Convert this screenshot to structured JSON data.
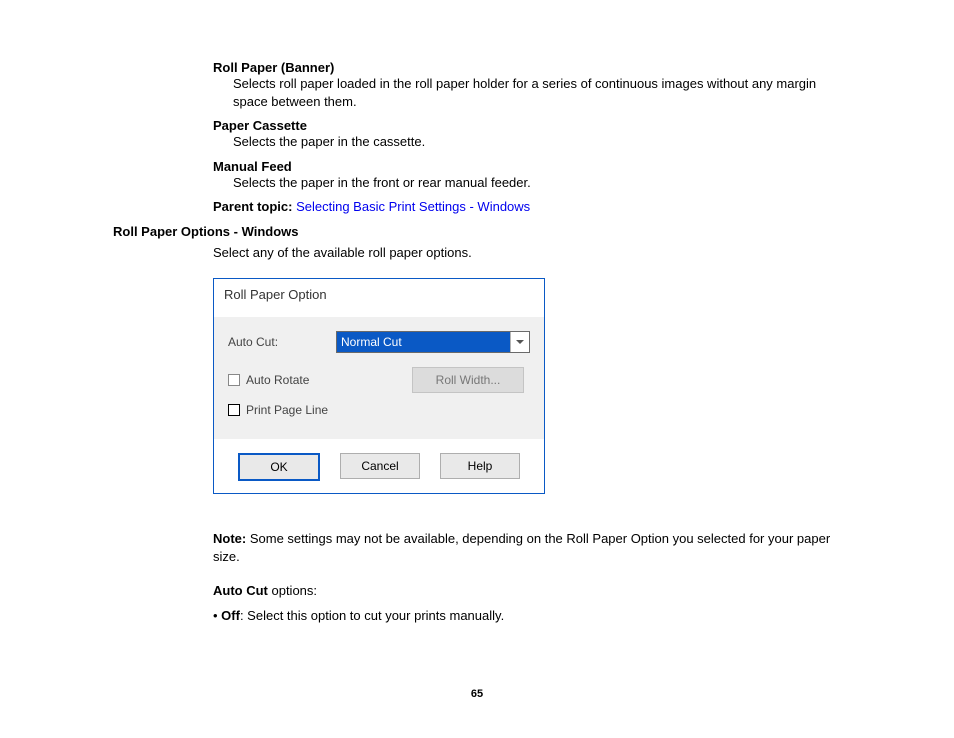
{
  "entries": {
    "rollPaperBanner": {
      "title": "Roll Paper (Banner)",
      "desc": "Selects roll paper loaded in the roll paper holder for a series of continuous images without any margin space between them."
    },
    "paperCassette": {
      "title": "Paper Cassette",
      "desc": "Selects the paper in the cassette."
    },
    "manualFeed": {
      "title": "Manual Feed",
      "desc": "Selects the paper in the front or rear manual feeder."
    }
  },
  "parentTopic": {
    "label": "Parent topic: ",
    "link": "Selecting Basic Print Settings - Windows"
  },
  "section": {
    "heading": "Roll Paper Options - Windows",
    "intro": "Select any of the available roll paper options."
  },
  "dialog": {
    "title": "Roll Paper Option",
    "autoCutLabel": "Auto Cut:",
    "autoCutValue": "Normal Cut",
    "autoRotate": "Auto Rotate",
    "rollWidth": "Roll Width...",
    "printPageLine": "Print Page Line",
    "ok": "OK",
    "cancel": "Cancel",
    "help": "Help"
  },
  "note": {
    "label": "Note: ",
    "text": "Some settings may not be available, depending on the Roll Paper Option you selected for your paper size."
  },
  "autoCutOptions": {
    "label": "Auto Cut",
    "suffix": " options:"
  },
  "bullet": {
    "prefix": "•  ",
    "offLabel": "Off",
    "offText": ": Select this option to cut your prints manually."
  },
  "pageNumber": "65"
}
